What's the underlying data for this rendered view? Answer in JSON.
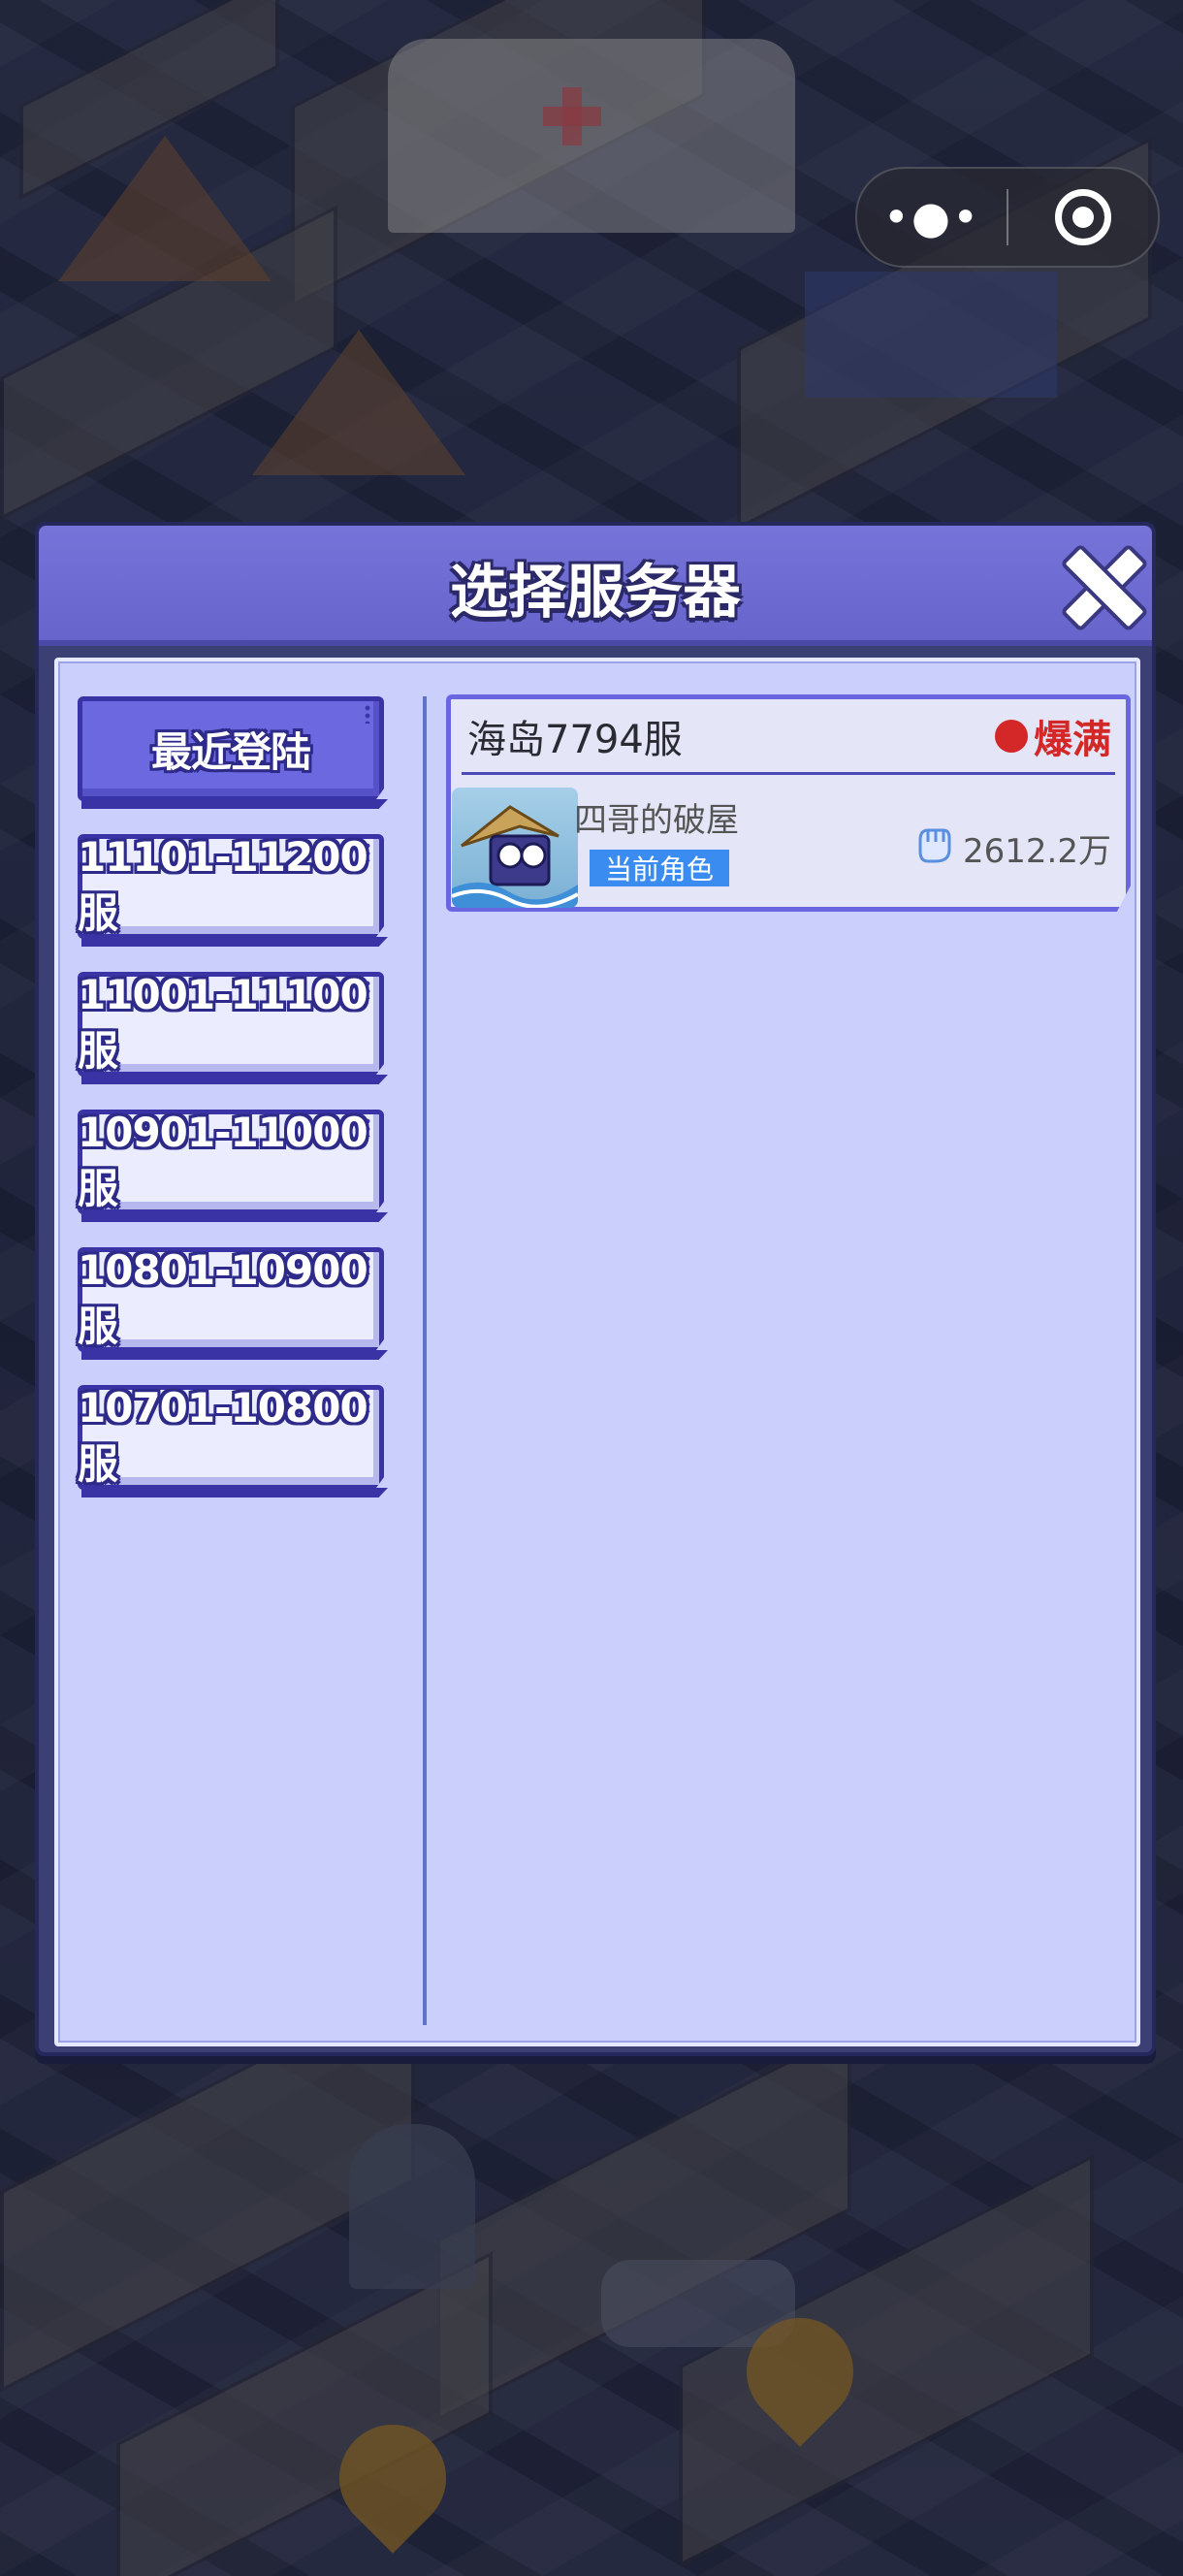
{
  "capsule": {
    "more_icon": "•●•",
    "close_icon": "target-icon"
  },
  "dialog": {
    "title": "选择服务器",
    "tabs": [
      {
        "label": "最近登陆",
        "active": true
      },
      {
        "label": "11101-11200服",
        "active": false
      },
      {
        "label": "11001-11100服",
        "active": false
      },
      {
        "label": "10901-11000服",
        "active": false
      },
      {
        "label": "10801-10900服",
        "active": false
      },
      {
        "label": "10701-10800服",
        "active": false
      }
    ],
    "server": {
      "name": "海岛7794服",
      "status": "爆满",
      "status_color": "#d42828",
      "role_name": "四哥的破屋",
      "current_badge": "当前角色",
      "power": "2612.2万",
      "power_icon": "fist-icon"
    }
  },
  "colors": {
    "accent": "#6b68e0",
    "panel": "#cbcffb",
    "badge": "#3a8cf0"
  }
}
